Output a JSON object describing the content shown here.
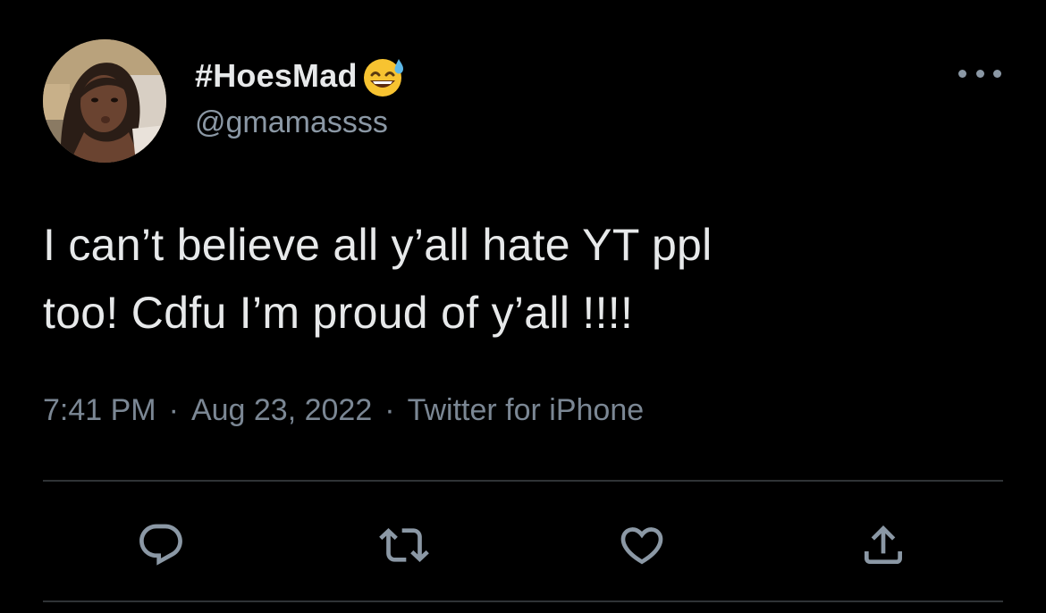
{
  "tweet": {
    "display_name": "#HoesMad",
    "display_name_emoji": "sweat-smile-emoji",
    "handle": "@gmamassss",
    "text": "I can’t believe all y’all hate YT ppl\ntoo! Cdfu I’m proud of y’all !!!!",
    "time": "7:41 PM",
    "date": "Aug 23, 2022",
    "source": "Twitter for iPhone",
    "separator": "·"
  },
  "actions": [
    {
      "name": "reply",
      "icon": "reply-icon"
    },
    {
      "name": "retweet",
      "icon": "retweet-icon"
    },
    {
      "name": "like",
      "icon": "heart-icon"
    },
    {
      "name": "share",
      "icon": "share-icon"
    }
  ],
  "colors": {
    "background": "#000000",
    "text_primary": "#e7e9ea",
    "text_secondary": "#8b98a5",
    "divider": "#2f3336"
  }
}
